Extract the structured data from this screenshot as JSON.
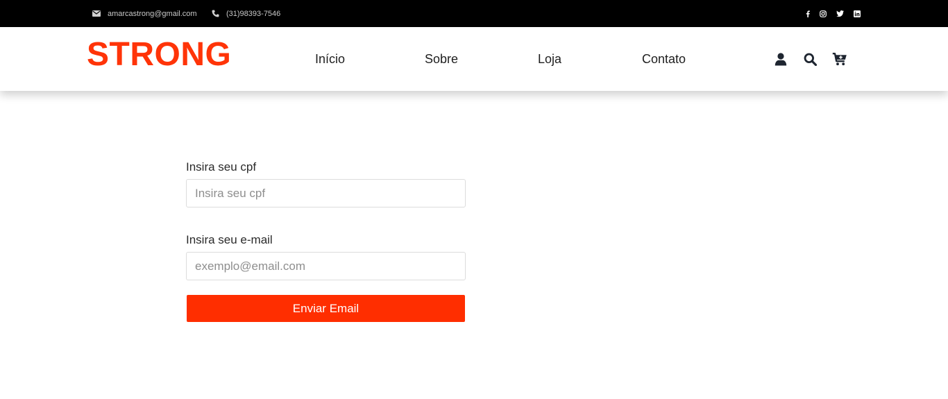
{
  "topbar": {
    "email": "amarcastrong@gmail.com",
    "phone": "(31)98393-7546",
    "social": [
      "facebook-icon",
      "instagram-icon",
      "twitter-icon",
      "linkedin-icon"
    ]
  },
  "header": {
    "logo": "STRONG",
    "nav": [
      "Início",
      "Sobre",
      "Loja",
      "Contato"
    ],
    "icons": [
      "user-icon",
      "search-icon",
      "cart-icon"
    ]
  },
  "form": {
    "cpf_label": "Insira seu cpf",
    "cpf_placeholder": "Insira seu cpf",
    "email_label": "Insira seu e-mail",
    "email_placeholder": "exemplo@email.com",
    "submit_label": "Enviar Email"
  },
  "colors": {
    "brand": "#ff3408",
    "button": "#ff2e00",
    "topbar_bg": "#000000"
  }
}
